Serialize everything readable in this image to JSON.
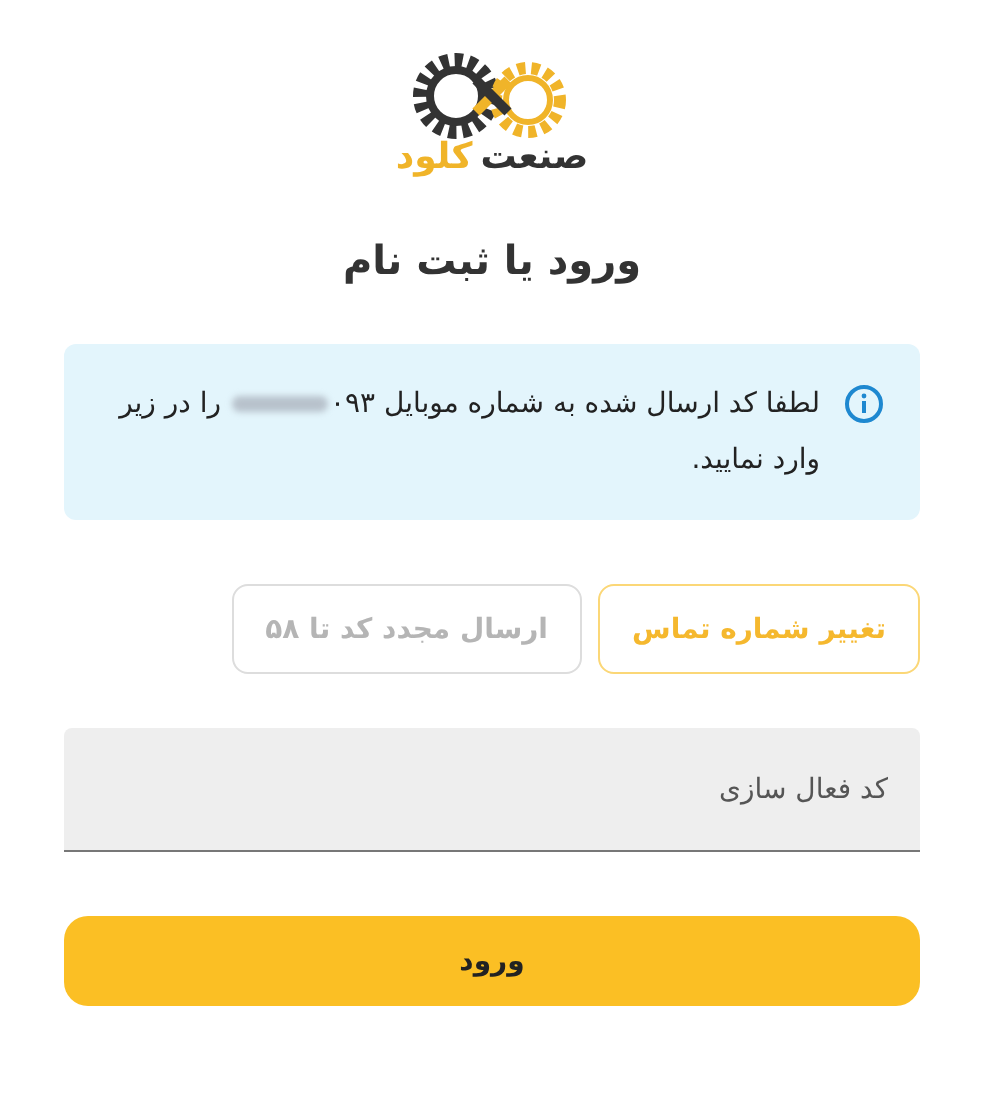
{
  "logo": {
    "word_1": "صنعت",
    "word_2": "کلود"
  },
  "title": "ورود یا ثبت نام",
  "alert": {
    "text_before": "لطفا کد ارسال شده به شماره موبایل ۰۹۳",
    "text_after": " را در زیر وارد نمایید.",
    "phone_redacted": true
  },
  "actions": [
    {
      "label": "تغییر شماره تماس",
      "disabled": false
    },
    {
      "label": "ارسال مجدد کد تا ۵۸",
      "disabled": true
    }
  ],
  "code_field": {
    "placeholder": "کد فعال سازی"
  },
  "submit": {
    "label": "ورود"
  }
}
